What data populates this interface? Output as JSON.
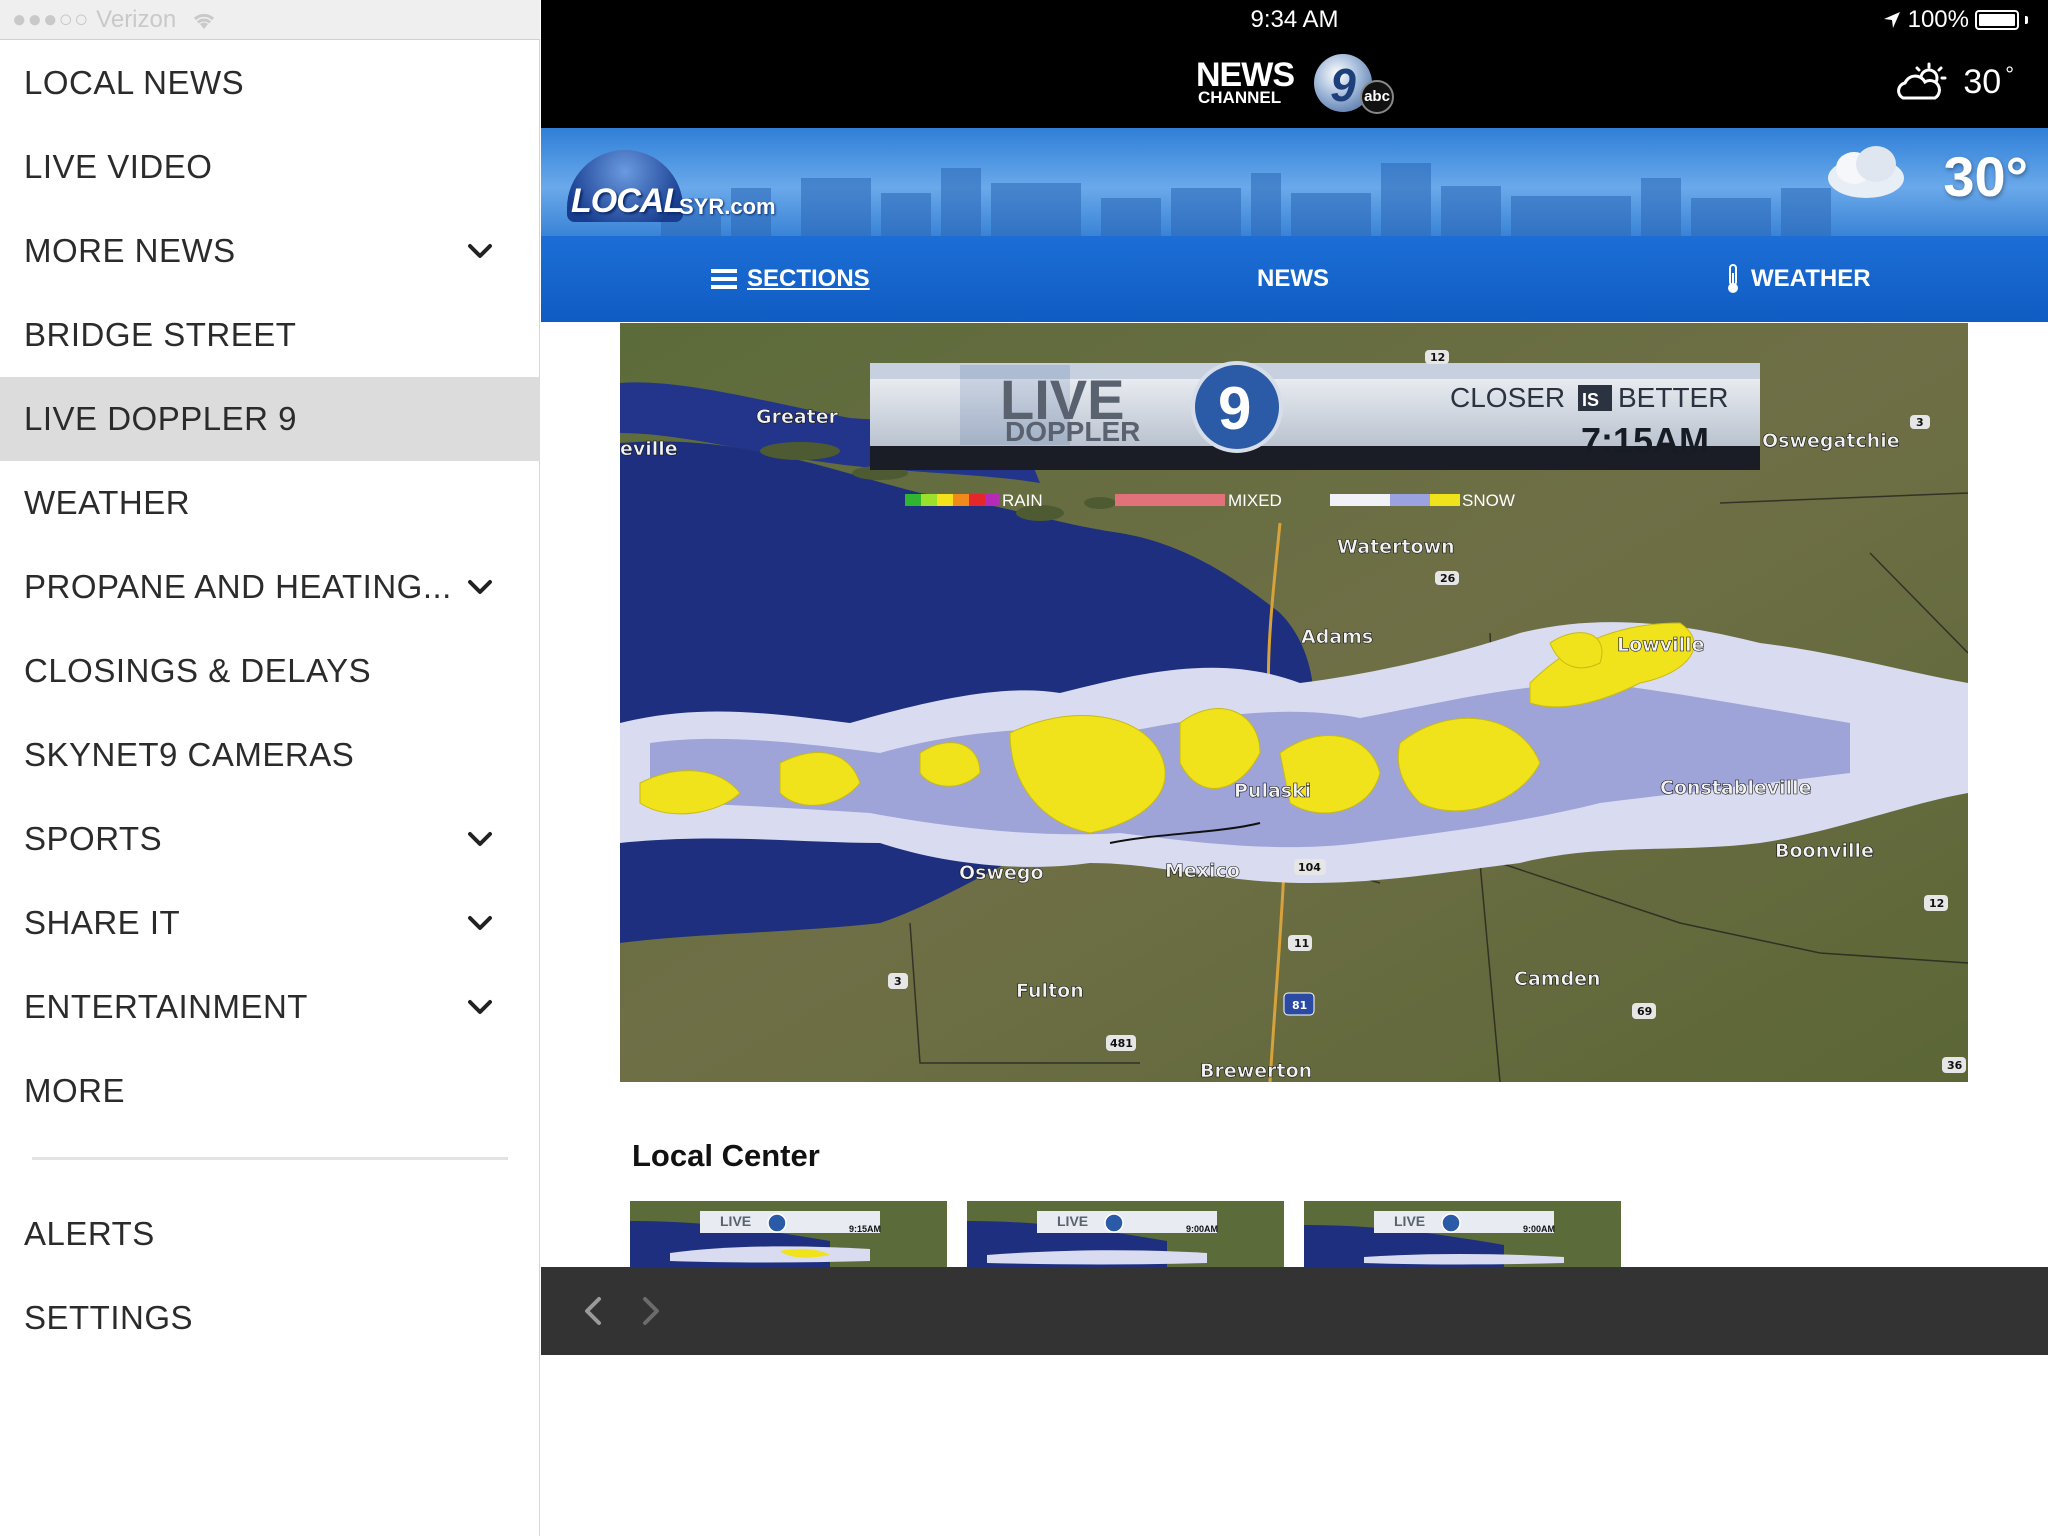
{
  "status_bar": {
    "carrier": "Verizon",
    "signal_dots": "●●●○○",
    "time": "9:34 AM",
    "battery": "100%"
  },
  "sidebar": {
    "items": [
      {
        "label": "LOCAL NEWS",
        "has_chevron": false
      },
      {
        "label": "LIVE VIDEO",
        "has_chevron": false
      },
      {
        "label": "MORE NEWS",
        "has_chevron": true
      },
      {
        "label": "BRIDGE STREET",
        "has_chevron": false
      },
      {
        "label": "LIVE DOPPLER 9",
        "has_chevron": false,
        "active": true
      },
      {
        "label": "WEATHER",
        "has_chevron": false
      },
      {
        "label": "PROPANE AND HEATING...",
        "has_chevron": true
      },
      {
        "label": "CLOSINGS & DELAYS",
        "has_chevron": false
      },
      {
        "label": "SKYNET9 CAMERAS",
        "has_chevron": false
      },
      {
        "label": "SPORTS",
        "has_chevron": true
      },
      {
        "label": "SHARE IT",
        "has_chevron": true
      },
      {
        "label": "ENTERTAINMENT",
        "has_chevron": true
      },
      {
        "label": "MORE",
        "has_chevron": false
      }
    ],
    "footer_items": [
      {
        "label": "ALERTS"
      },
      {
        "label": "SETTINGS"
      }
    ]
  },
  "header": {
    "logo_news": "NEWS",
    "logo_channel": "CHANNEL",
    "logo_nine": "9",
    "logo_abc": "abc",
    "temperature": "30",
    "degree": "°"
  },
  "banner": {
    "logo_word": "LOCAL",
    "logo_domain": "SYR.com",
    "temperature": "30°"
  },
  "nav": {
    "sections": "SECTIONS",
    "news": "NEWS",
    "weather": "WEATHER"
  },
  "radar": {
    "brand_live": "LIVE",
    "brand_doppler": "DOPPLER",
    "brand_nine": "9",
    "tagline_closer": "CLOSER",
    "tagline_is": "IS",
    "tagline_better": "BETTER",
    "time": "7:15AM",
    "legend": [
      "RAIN",
      "MIXED",
      "SNOW"
    ],
    "places": [
      "Greater",
      "eville",
      "Oswegatchie",
      "Watertown",
      "Adams",
      "Lowville",
      "Pulaski",
      "Constableville",
      "Boonville",
      "Oswego",
      "Mexico",
      "Camden",
      "Fulton",
      "Brewerton"
    ],
    "routes": [
      "12",
      "3",
      "26",
      "104",
      "11",
      "81",
      "481",
      "69",
      "36",
      "3",
      "12"
    ]
  },
  "local_center": {
    "title": "Local Center",
    "thumbnails": [
      {
        "time": "9:15AM"
      },
      {
        "time": "9:00AM"
      },
      {
        "time": "9:00AM"
      }
    ]
  },
  "colors": {
    "nav_blue": "#1565cf",
    "snow_yellow": "#f0e21b",
    "lake_blue": "#1d2f7e"
  }
}
